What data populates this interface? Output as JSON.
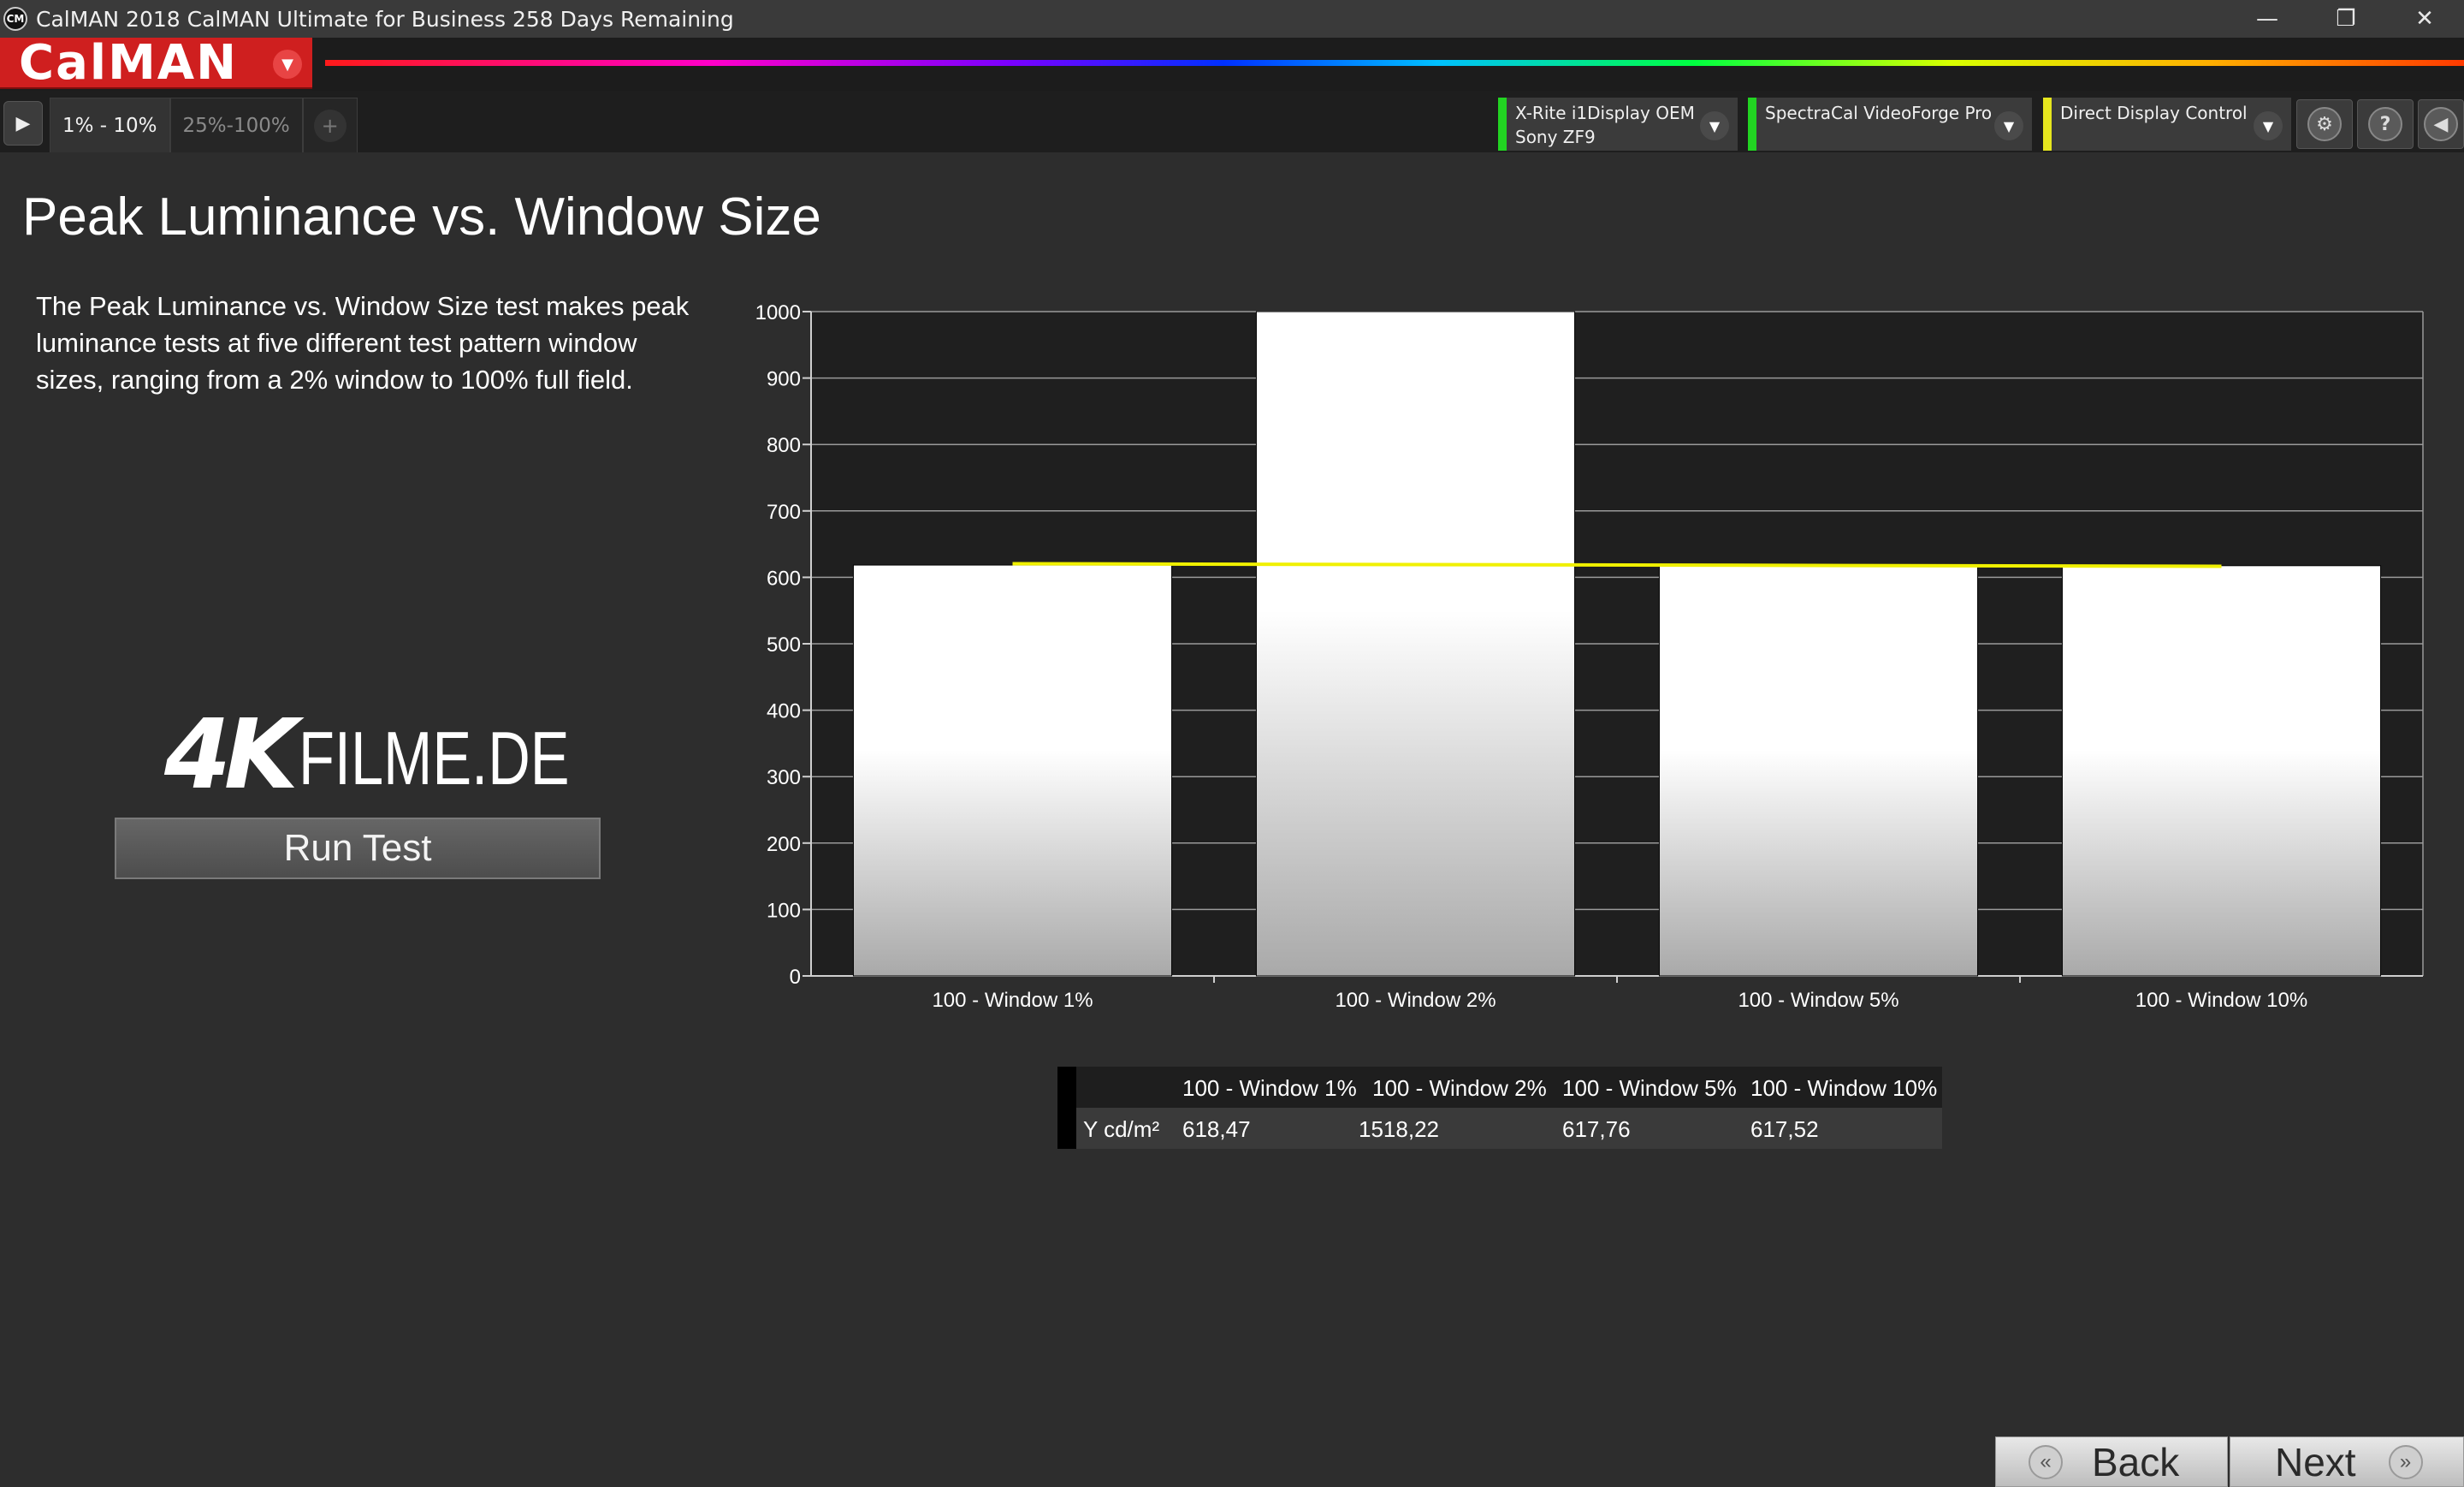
{
  "window": {
    "app_icon": "CM",
    "title": "CalMAN 2018 CalMAN Ultimate for Business 258 Days Remaining",
    "controls": {
      "minimize": "—",
      "restore": "❐",
      "close": "✕"
    }
  },
  "brand": {
    "logo": "CalMAN",
    "logo_dropdown": "▼"
  },
  "toolbar": {
    "play": "▶",
    "tabs": [
      {
        "label": "1% - 10%",
        "active": true
      },
      {
        "label": "25%-100%",
        "active": false
      }
    ],
    "add_tab": "+",
    "devices": [
      {
        "line1": "X-Rite i1Display OEM",
        "line2": "Sony ZF9",
        "status_color": "#22d422"
      },
      {
        "line1": "SpectraCal VideoForge Pro",
        "line2": "",
        "status_color": "#22d422"
      },
      {
        "line1": "Direct Display Control",
        "line2": "",
        "status_color": "#e6e61e"
      }
    ],
    "dropdown": "▼",
    "settings": "⚙",
    "help": "?",
    "collapse": "◀"
  },
  "page": {
    "title": "Peak Luminance vs. Window Size",
    "description": "The Peak Luminance vs. Window Size test makes peak luminance tests at five different test pattern window sizes, ranging from a 2% window to 100% full field.",
    "brand_mark": {
      "lead": "4K",
      "rest": "FILME.DE"
    },
    "run_test": "Run Test"
  },
  "chart_data": {
    "type": "bar",
    "categories": [
      "100 - Window  1%",
      "100 - Window  2%",
      "100 - Window  5%",
      "100 - Window 10%"
    ],
    "values": [
      618.47,
      1518.22,
      617.76,
      617.52
    ],
    "ylim": [
      0,
      1000
    ],
    "yticks": [
      0,
      100,
      200,
      300,
      400,
      500,
      600,
      700,
      800,
      900,
      1000
    ],
    "grid": true,
    "average_line": {
      "value": 617.92,
      "color": "#f0f000"
    },
    "bar_color": "#ffffff",
    "background": "#1f1f1f"
  },
  "table": {
    "columns": [
      "100 - Window  1%",
      "100 - Window  2%",
      "100 - Window  5%",
      "100 - Window 10%"
    ],
    "row_label": "Y cd/m²",
    "values": [
      "618,47",
      "1518,22",
      "617,76",
      "617,52"
    ]
  },
  "nav": {
    "back": "Back",
    "next": "Next",
    "back_icon": "«",
    "next_icon": "»"
  }
}
